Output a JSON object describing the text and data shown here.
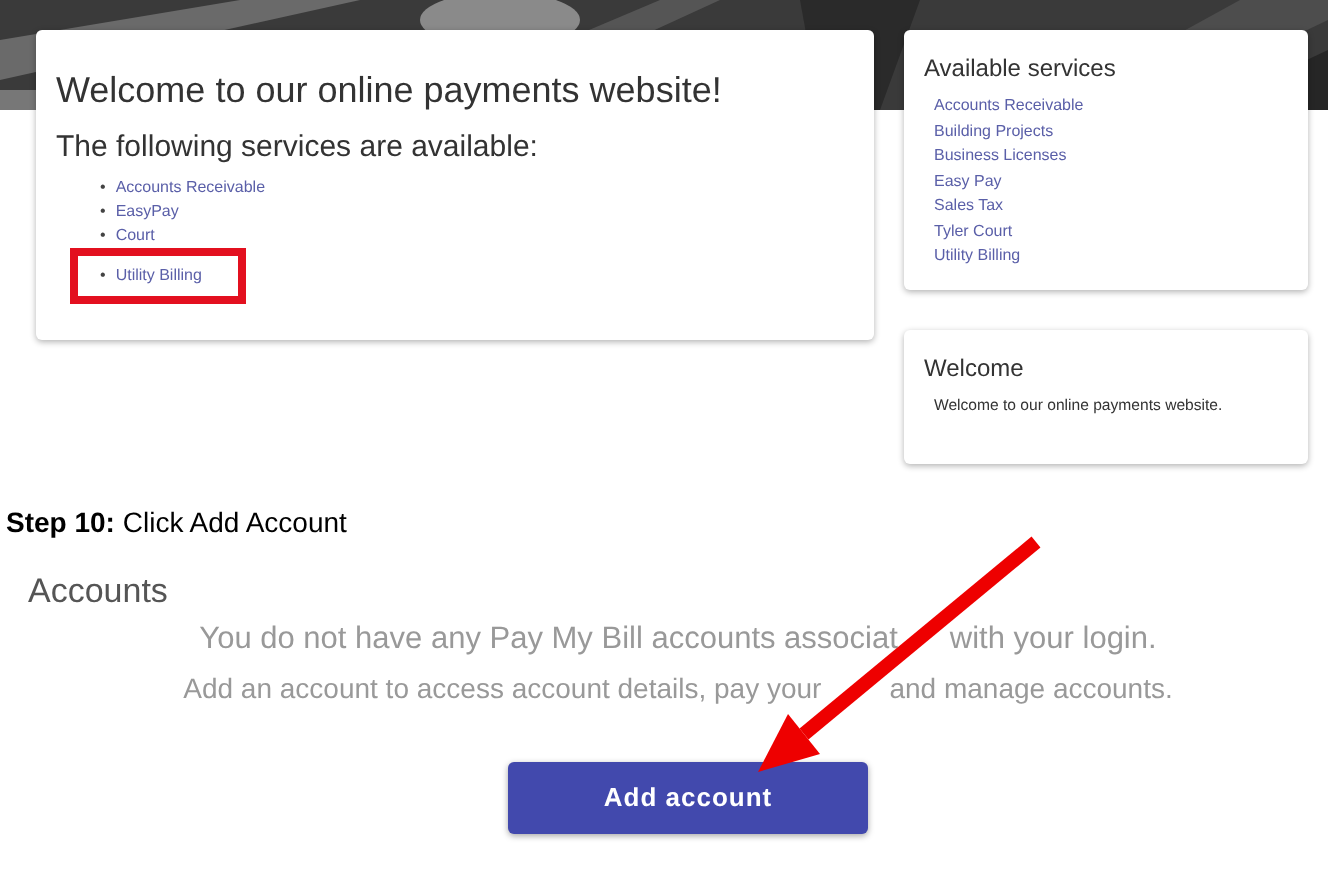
{
  "portal": {
    "welcome_card": {
      "title": "Welcome to our online payments website!",
      "subtitle": "The following services are available:",
      "marker": "•",
      "services": [
        {
          "label": "Accounts Receivable",
          "highlighted": false
        },
        {
          "label": "EasyPay",
          "highlighted": false
        },
        {
          "label": "Court",
          "highlighted": false
        },
        {
          "label": "Utility Billing",
          "highlighted": true
        }
      ]
    },
    "sidebar": {
      "title": "Available services",
      "services": [
        "Accounts Receivable",
        "Building Projects",
        "Business Licenses",
        "Easy Pay",
        "Sales Tax",
        "Tyler Court",
        "Utility Billing"
      ]
    },
    "welcome_box": {
      "title": "Welcome",
      "text": "Welcome to our online payments website."
    }
  },
  "step": "**Step 10:** Click Add Account",
  "accounts": {
    "title": "Accounts",
    "message_lines": [
      [
        "You do not have any Pay My Bill accounts associat",
        "with your login."
      ],
      [
        "Add an account to access account details, pay your",
        "and manage accounts."
      ]
    ],
    "button": "Add account"
  }
}
